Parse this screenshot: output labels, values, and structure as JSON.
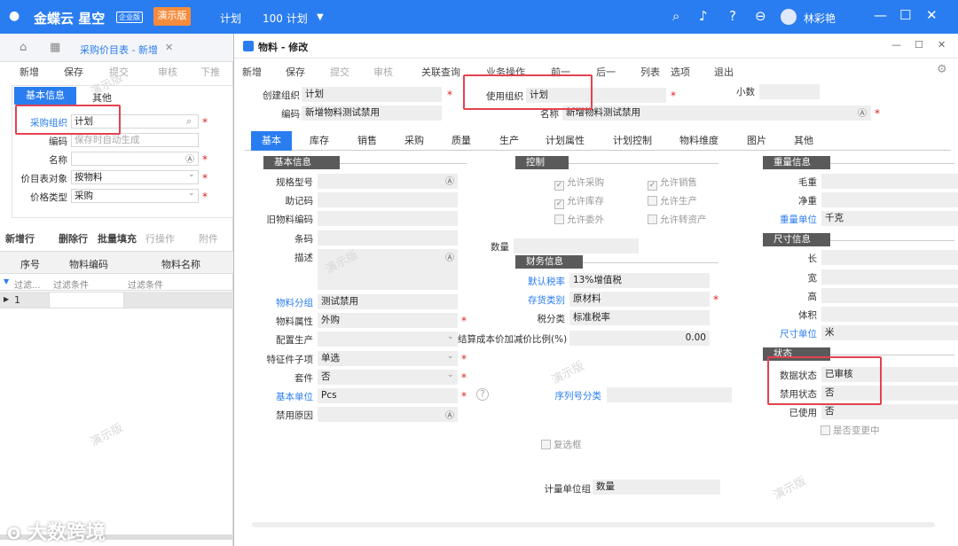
{
  "topbar": {
    "logo": "金蝶云 星空",
    "edition": "企业版",
    "demo_btn": "演示版",
    "menu1": "计划",
    "menu2": "100 计划",
    "user": "林彩艳"
  },
  "left": {
    "home": "首页",
    "page_tab": "采购价目表 - 新增",
    "toolbar": {
      "new": "新增",
      "save": "保存",
      "submit": "提交",
      "audit": "审核",
      "push": "下推"
    },
    "subtabs": {
      "basic": "基本信息",
      "other": "其他"
    },
    "form": {
      "purchase_org_label": "采购组织",
      "purchase_org": "计划",
      "code_label": "编码",
      "code_placeholder": "保存时自动生成",
      "name_label": "名称",
      "target_label": "价目表对象",
      "target": "按物料",
      "price_type_label": "价格类型",
      "price_type": "采购"
    },
    "grid_toolbar": {
      "add_row": "新增行",
      "del_row": "删除行",
      "batch_fill": "批量填充",
      "row_op": "行操作",
      "attach": "附件"
    },
    "grid": {
      "col_seq": "序号",
      "col_code": "物料编码",
      "col_name": "物料名称",
      "filter1": "过滤...",
      "filter2": "过滤条件",
      "filter3": "过滤条件",
      "row1": "1"
    }
  },
  "dialog": {
    "title": "物料 - 修改",
    "toolbar": {
      "new": "新增",
      "save": "保存",
      "submit": "提交",
      "audit": "审核",
      "related": "关联查询",
      "business": "业务操作",
      "prev": "前一",
      "next": "后一",
      "list": "列表",
      "options": "选项",
      "exit": "退出"
    },
    "header": {
      "create_org_label": "创建组织",
      "create_org": "计划",
      "use_org_label": "使用组织",
      "use_org": "计划",
      "decimal_label": "小数",
      "code_label": "编码",
      "code": "新增物料测试禁用",
      "name_label": "名称",
      "name": "新增物料测试禁用"
    },
    "tabs": [
      "基本",
      "库存",
      "销售",
      "采购",
      "质量",
      "生产",
      "计划属性",
      "计划控制",
      "物料维度",
      "图片",
      "其他"
    ],
    "basic": {
      "title": "基本信息",
      "spec": "规格型号",
      "mnemonic": "助记码",
      "old_code": "旧物料编码",
      "barcode": "条码",
      "desc": "描述",
      "group_label": "物料分组",
      "group": "测试禁用",
      "attr_label": "物料属性",
      "attr": "外购",
      "config_label": "配置生产",
      "feature_label": "特征件子项",
      "feature": "单选",
      "kit_label": "套件",
      "kit": "否",
      "unit_label": "基本单位",
      "unit": "Pcs",
      "disable_reason_label": "禁用原因"
    },
    "control": {
      "title": "控制",
      "allow_purchase": "允许采购",
      "allow_sale": "允许销售",
      "allow_stock": "允许库存",
      "allow_produce": "允许生产",
      "allow_outsource": "允许委外",
      "allow_asset": "允许转资产"
    },
    "qty_label": "数量",
    "finance": {
      "title": "财务信息",
      "tax_label": "默认税率",
      "tax": "13%增值税",
      "stock_cat_label": "存货类别",
      "stock_cat": "原材料",
      "tax_class_label": "税分类",
      "tax_class": "标准税率",
      "ratio_label": "结算成本价加减价比例(%)",
      "ratio": "0.00"
    },
    "serial_label": "序列号分类",
    "reuse_label": "复选框",
    "measure_group_label": "计量单位组",
    "measure_group": "数量",
    "weight": {
      "title": "重量信息",
      "gross": "毛重",
      "net": "净重",
      "unit_label": "重量单位",
      "unit": "千克"
    },
    "size": {
      "title": "尺寸信息",
      "length": "长",
      "width": "宽",
      "height": "高",
      "volume": "体积",
      "unit_label": "尺寸单位",
      "unit": "米"
    },
    "status": {
      "title": "状态",
      "data_status_label": "数据状态",
      "data_status": "已审核",
      "forbid_label": "禁用状态",
      "forbid": "否",
      "used_label": "已使用",
      "used": "否",
      "changing_label": "是否变更中"
    }
  },
  "watermark": "演示版",
  "bottom_logo": "大数跨境",
  "colors": {
    "brand": "#2a7df0",
    "highlight": "#e4424f",
    "demo": "#f58c3c"
  }
}
